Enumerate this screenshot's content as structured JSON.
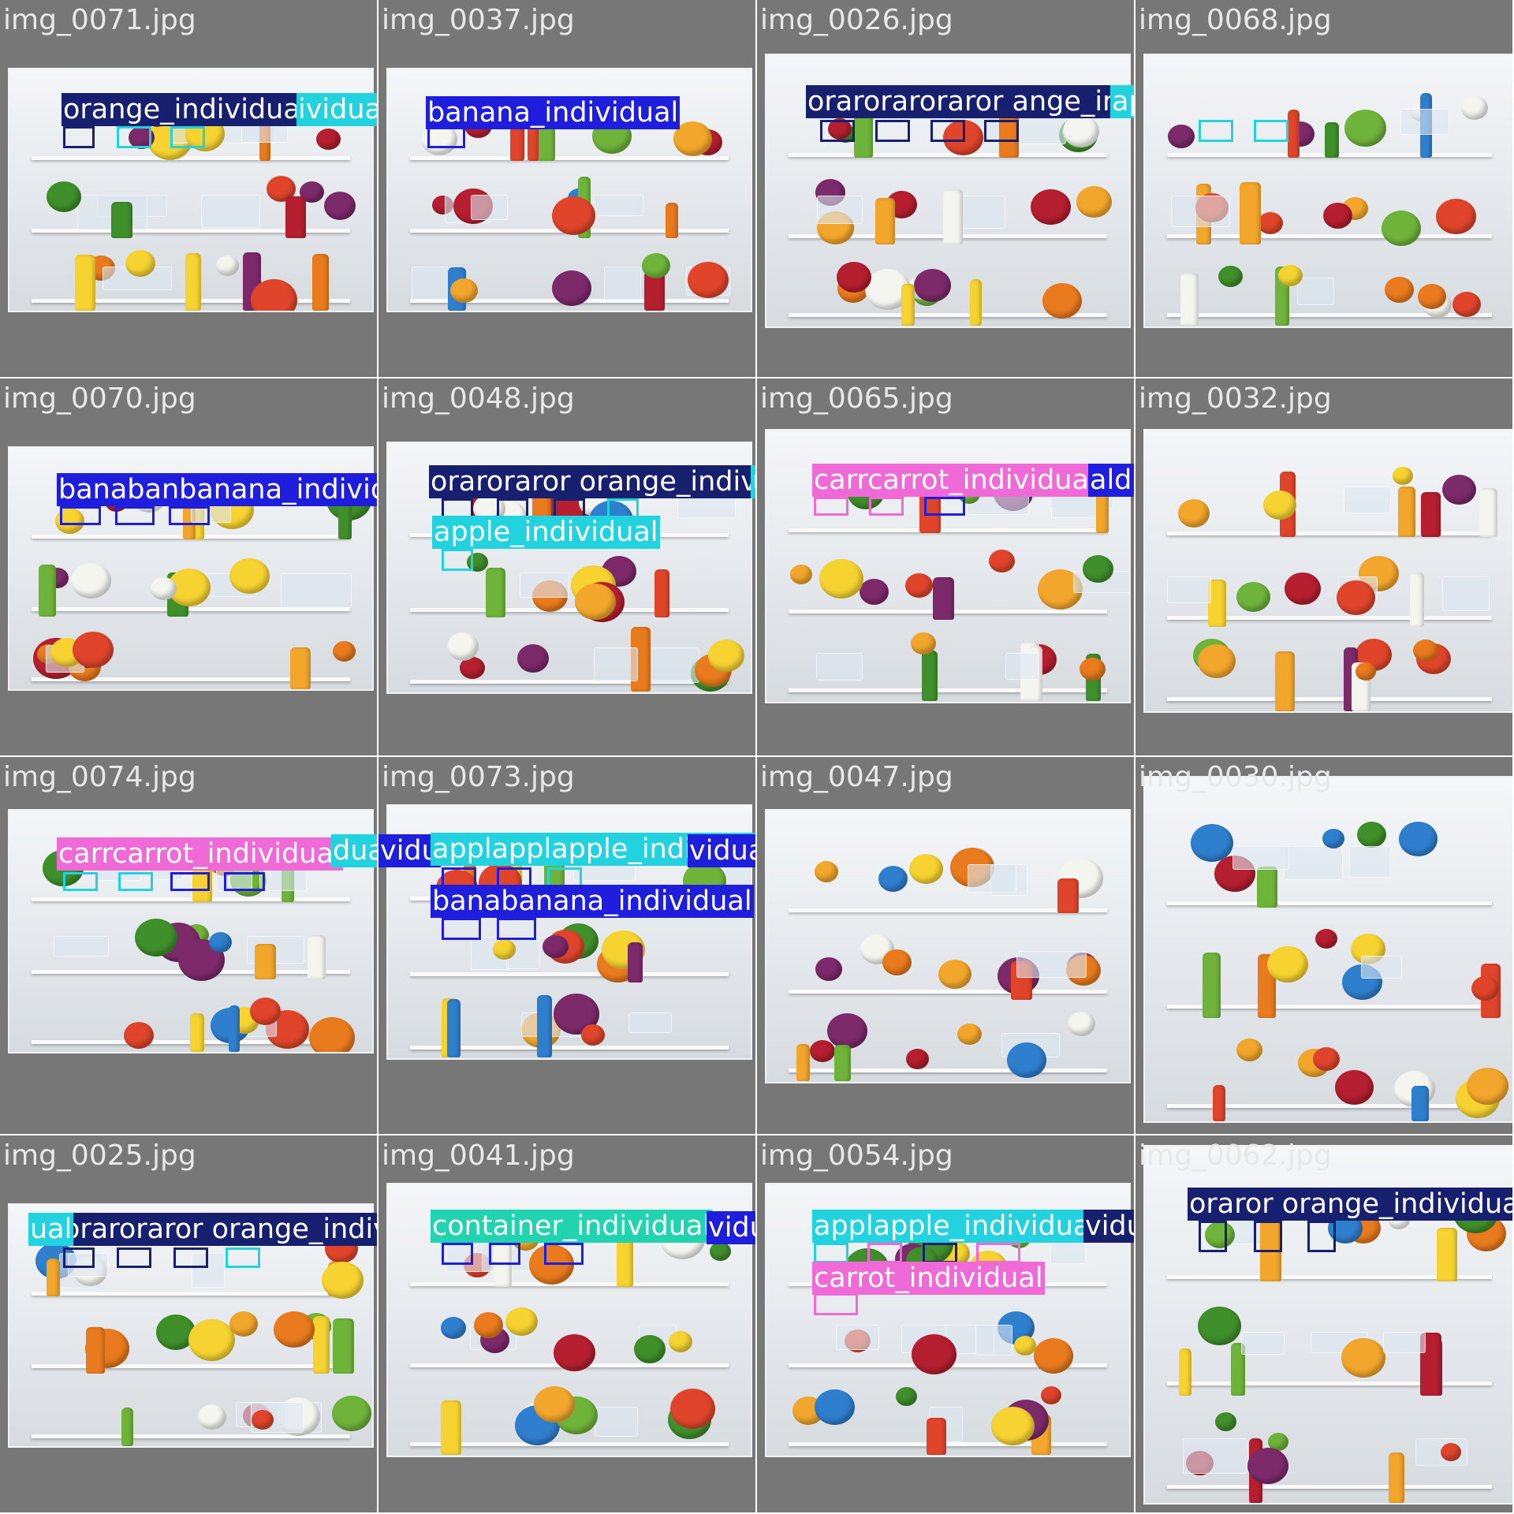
{
  "colors": {
    "orange_individual": "#17206e",
    "banana_individual": "#1e1edc",
    "apple_individual": "#22d3df",
    "carrot_individual": "#f06ad7",
    "container_individual": "#22d3b0",
    "label_text_dark_bg": "#ffffff",
    "label_text_light_bg": "#ffffff",
    "cell_background": "#777777"
  },
  "cells": [
    {
      "title": "img_0071.jpg",
      "labels": [
        {
          "text": "orange_individual",
          "cls": "orange_individual"
        },
        {
          "text": "ividual",
          "cls": "apple_individual"
        }
      ]
    },
    {
      "title": "img_0037.jpg",
      "labels": [
        {
          "text": "banana_individual",
          "cls": "banana_individual"
        }
      ]
    },
    {
      "title": "img_0026.jpg",
      "labels": [
        {
          "text": "oraroraroraror ange_individual",
          "cls": "orange_individual"
        },
        {
          "text": "applapple_individual",
          "cls": "apple_individual"
        }
      ]
    },
    {
      "title": "img_0068.jpg",
      "labels": []
    },
    {
      "title": "img_0070.jpg",
      "labels": [
        {
          "text": "banabanbanana_individual",
          "cls": "banana_individual"
        }
      ]
    },
    {
      "title": "img_0048.jpg",
      "labels": [
        {
          "text": "oraroraror orange_individual",
          "cls": "orange_individual"
        },
        {
          "text": "ual",
          "cls": "apple_individual"
        },
        {
          "text": "apple_individual",
          "cls": "apple_individual"
        }
      ]
    },
    {
      "title": "img_0065.jpg",
      "labels": [
        {
          "text": "carrcarrot_individual",
          "cls": "carrot_individual"
        },
        {
          "text": "aldual",
          "cls": "banana_individual"
        }
      ]
    },
    {
      "title": "img_0032.jpg",
      "labels": []
    },
    {
      "title": "img_0074.jpg",
      "labels": [
        {
          "text": "carrcarrot_individual",
          "cls": "carrot_individual"
        },
        {
          "text": "dual",
          "cls": "apple_individual"
        }
      ]
    },
    {
      "title": "img_0073.jpg",
      "labels": [
        {
          "text": "vidu",
          "cls": "banana_individual"
        },
        {
          "text": "applapplapple_individual",
          "cls": "apple_individual"
        },
        {
          "text": "vidual",
          "cls": "banana_individual"
        },
        {
          "text": "banabanana_individual",
          "cls": "banana_individual"
        }
      ]
    },
    {
      "title": "img_0047.jpg",
      "labels": []
    },
    {
      "title": "img_0030.jpg",
      "labels": []
    },
    {
      "title": "img_0025.jpg",
      "labels": [
        {
          "text": "oraroraror orange_individual",
          "cls": "orange_individual"
        },
        {
          "text": "ual",
          "cls": "apple_individual"
        }
      ]
    },
    {
      "title": "img_0041.jpg",
      "labels": [
        {
          "text": "container_individual",
          "cls": "container_individual"
        },
        {
          "text": "vidual",
          "cls": "banana_individual"
        }
      ]
    },
    {
      "title": "img_0054.jpg",
      "labels": [
        {
          "text": "applapple_individual",
          "cls": "apple_individual"
        },
        {
          "text": "vidual",
          "cls": "orange_individual"
        },
        {
          "text": "ual",
          "cls": "carrot_individual"
        },
        {
          "text": "carrot_individual",
          "cls": "carrot_individual"
        }
      ]
    },
    {
      "title": "img_0062.jpg",
      "labels": [
        {
          "text": "oraror orange_individual",
          "cls": "orange_individual"
        }
      ]
    }
  ]
}
